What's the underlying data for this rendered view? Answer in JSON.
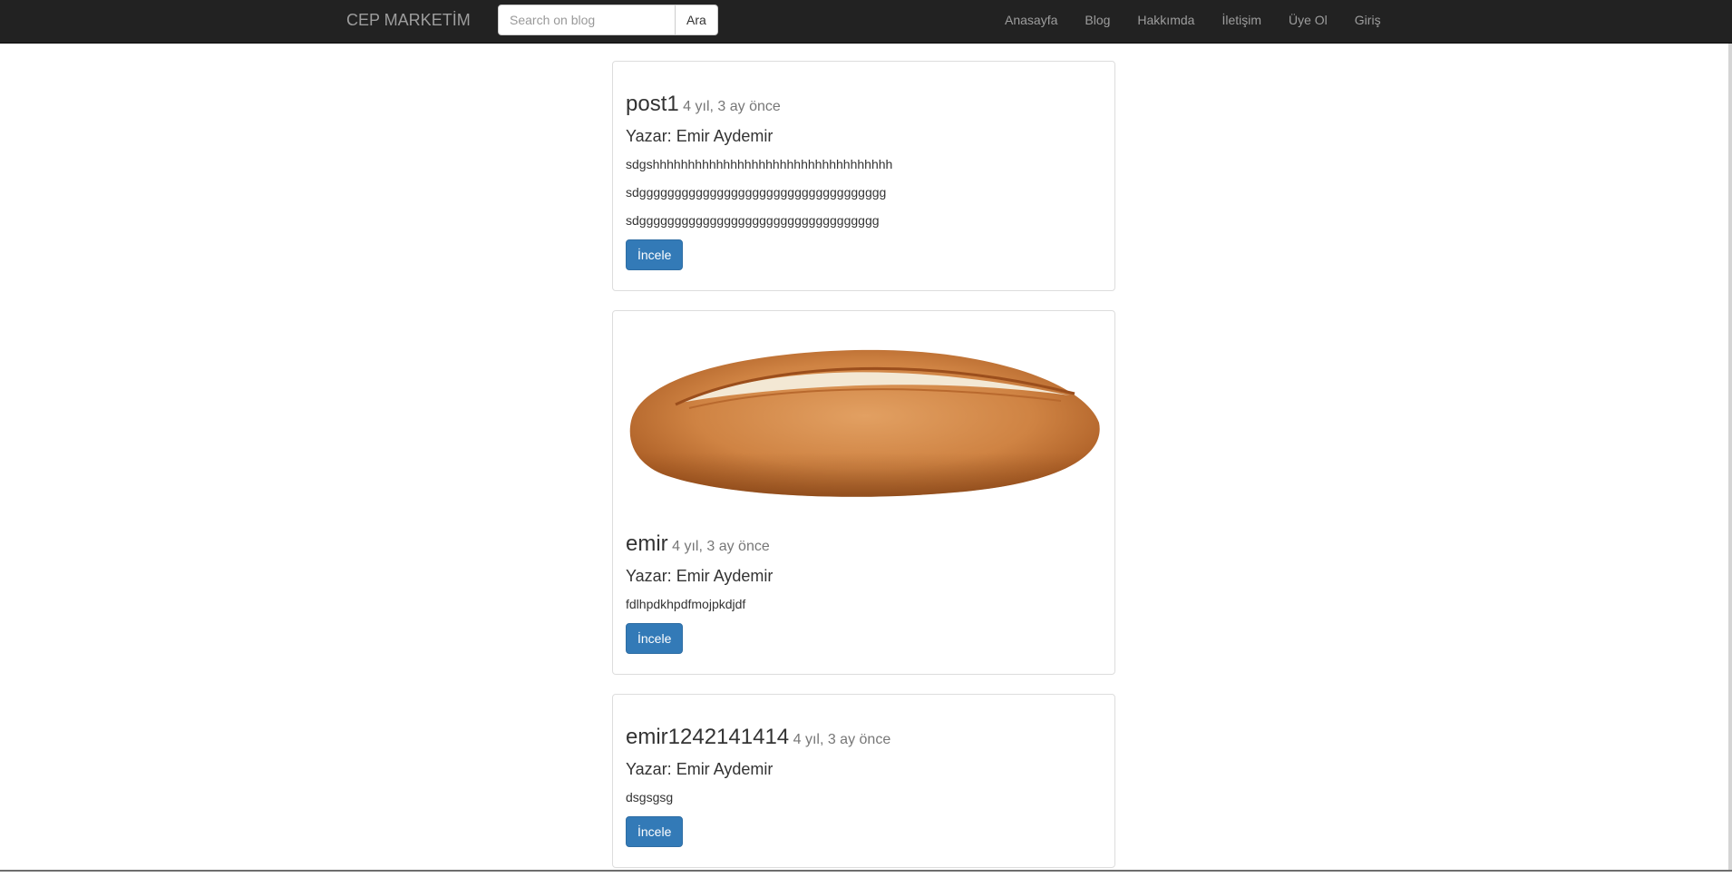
{
  "header": {
    "brand": "CEP MARKETİM",
    "search": {
      "placeholder": "Search on blog",
      "value": "",
      "button_label": "Ara"
    },
    "nav_items": [
      "Anasayfa",
      "Blog",
      "Hakkımda",
      "İletişim",
      "Üye Ol",
      "Giriş"
    ]
  },
  "posts": [
    {
      "title": "post1",
      "time": "4 yıl, 3 ay önce",
      "author": "Yazar: Emir Aydemir",
      "lines": [
        "sdgshhhhhhhhhhhhhhhhhhhhhhhhhhhhhhhhhh",
        "sdggggggggggggggggggggggggggggggggggg",
        "sdgggggggggggggggggggggggggggggggggg"
      ],
      "button_label": "İncele"
    },
    {
      "image": "bread-loaf",
      "title": "emir",
      "time": "4 yıl, 3 ay önce",
      "author": "Yazar: Emir Aydemir",
      "lines": [
        "fdlhpdkhpdfmojpkdjdf"
      ],
      "button_label": "İncele"
    },
    {
      "title": "emir1242141414",
      "time": "4 yıl, 3 ay önce",
      "author": "Yazar: Emir Aydemir",
      "lines": [
        "dsgsgsg"
      ],
      "button_label": "İncele"
    }
  ],
  "colors": {
    "navbar_bg": "#222222",
    "nav_text": "#9d9d9d",
    "primary_button": "#337ab7",
    "muted_text": "#777777"
  }
}
